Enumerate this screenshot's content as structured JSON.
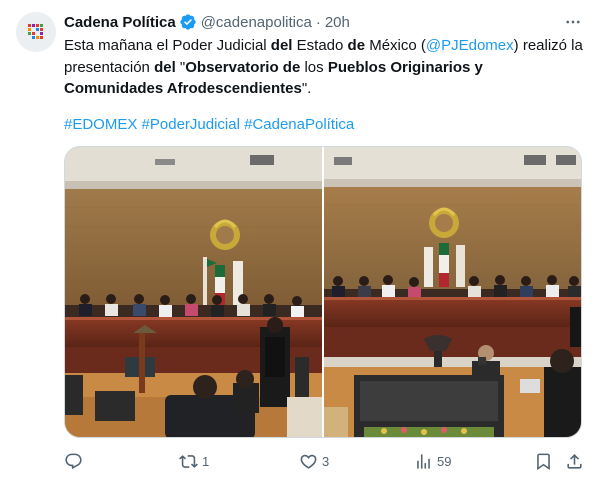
{
  "tweet": {
    "author_name": "Cadena Política",
    "handle": "@cadenapolitica",
    "separator": "·",
    "timestamp": "20h",
    "text_parts": {
      "p1": "Esta mañana el Poder Judicial ",
      "p2": "del",
      "p3": " Estado ",
      "p4": "de",
      "p5": " México (",
      "mention": "@PJEdomex",
      "p6": ") realizó la presentación ",
      "p7": "del",
      "p8": " \"",
      "p9": "Observatorio de",
      "p10": " los ",
      "p11": "Pueblos Originarios y Comunidades Afrodescendientes",
      "p12": "\"."
    },
    "hashtags": [
      "#EDOMEX",
      "#PoderJudicial",
      "#CadenaPolítica"
    ]
  },
  "media": {
    "photos": [
      {
        "alt": "Presentación en sala de plenos, vista con intérprete de pie"
      },
      {
        "alt": "Presentación en sala de plenos, vista frontal del presídium"
      }
    ]
  },
  "actions": {
    "reply_count": "",
    "retweet_count": "1",
    "like_count": "3",
    "views_count": "59"
  },
  "icons": {
    "more": "more-horizontal-icon",
    "verified": "verified-badge-icon",
    "reply": "reply-icon",
    "retweet": "retweet-icon",
    "like": "heart-icon",
    "views": "views-chart-icon",
    "bookmark": "bookmark-icon",
    "share": "share-icon"
  },
  "colors": {
    "accent": "#1d9bf0",
    "text": "#0f1419",
    "secondary": "#536471"
  }
}
